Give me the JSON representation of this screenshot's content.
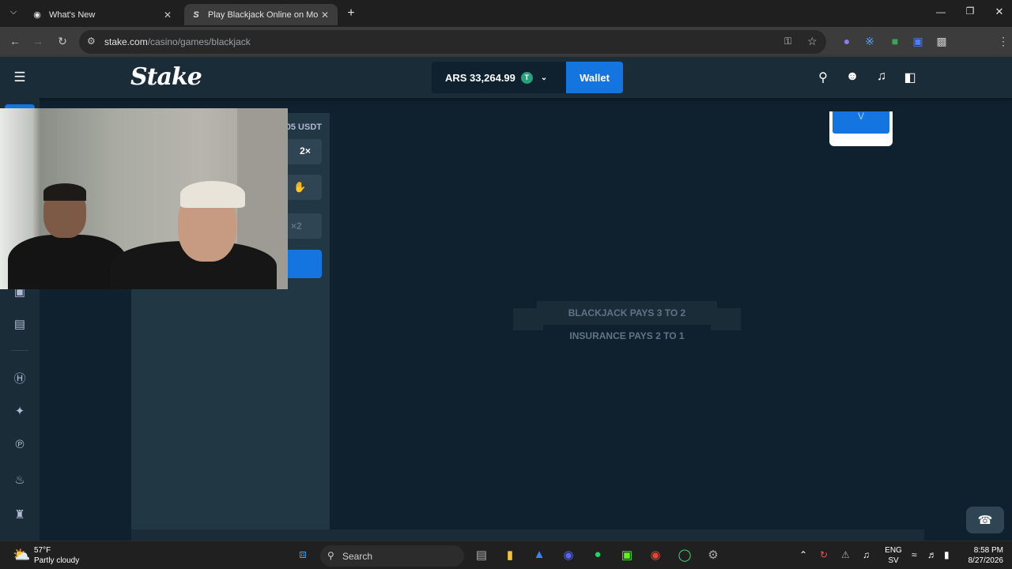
{
  "browser": {
    "tabs": [
      {
        "title": "What's New",
        "active": false
      },
      {
        "title": "Play Blackjack Online on Mobile",
        "active": true
      }
    ],
    "url_host": "stake.com",
    "url_path": "/casino/games/blackjack"
  },
  "header": {
    "logo": "Stake",
    "balance": "ARS 33,264.99",
    "currency_badge": "T",
    "wallet_label": "Wallet"
  },
  "controls": {
    "bet_label_partial": "05 USDT",
    "double_label": "2×",
    "split_label_partial": "×2"
  },
  "table": {
    "ribbon_main": "BLACKJACK PAYS 3 TO 2",
    "ribbon_sub": "INSURANCE PAYS 2 TO 1",
    "card_mark": "V"
  },
  "taskbar": {
    "temperature": "57°F",
    "condition": "Partly cloudy",
    "search_placeholder": "Search",
    "lang_line1": "ENG",
    "lang_line2": "SV",
    "time": "8:58 PM",
    "date": "8/27/2026"
  },
  "colors": {
    "accent": "#1475e1",
    "background": "#0f212e",
    "panel": "#1a2c38",
    "usdt": "#26a17b"
  }
}
